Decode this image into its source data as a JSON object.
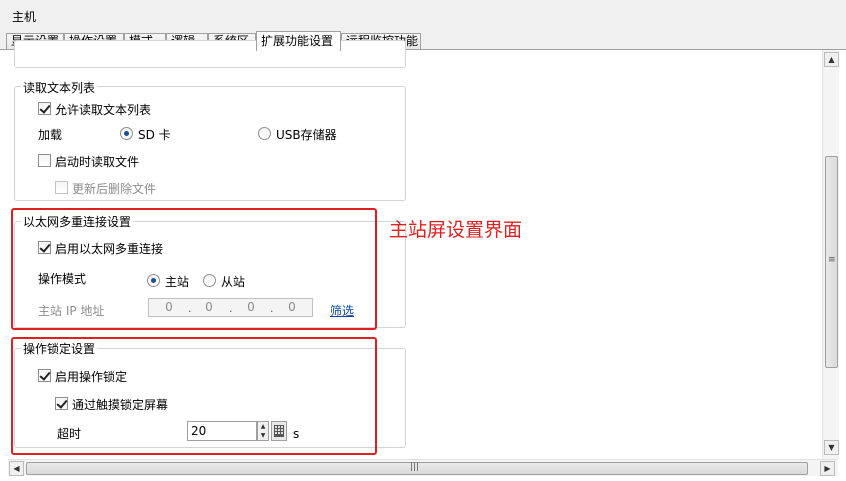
{
  "window": {
    "title": "主机"
  },
  "tabs": [
    {
      "label": "显示设置",
      "active": false
    },
    {
      "label": "操作设置",
      "active": false
    },
    {
      "label": "模式",
      "active": false
    },
    {
      "label": "逻辑",
      "active": false
    },
    {
      "label": "系统区",
      "active": false
    },
    {
      "label": "扩展功能设置",
      "active": true
    },
    {
      "label": "远程监控功能",
      "active": false
    }
  ],
  "read_text": {
    "title": "读取文本列表",
    "allow_label": "允许读取文本列表",
    "allow_checked": true,
    "load_label": "加载",
    "options": [
      "SD 卡",
      "USB存储器"
    ],
    "selected": "SD 卡",
    "startup_label": "启动时读取文件",
    "startup_checked": false,
    "delete_label": "更新后删除文件",
    "delete_checked": false
  },
  "ethernet": {
    "title": "以太网多重连接设置",
    "enable_label": "启用以太网多重连接",
    "enable_checked": true,
    "mode_label": "操作模式",
    "mode_options": [
      "主站",
      "从站"
    ],
    "mode_selected": "主站",
    "ip_label": "主站 IP 地址",
    "ip": [
      "0",
      "0",
      "0",
      "0"
    ],
    "filter_link": "筛选"
  },
  "annotation": {
    "text": "主站屏设置界面",
    "color": "#e02020"
  },
  "lock": {
    "title": "操作锁定设置",
    "enable_label": "启用操作锁定",
    "enable_checked": true,
    "touch_label": "通过触摸锁定屏幕",
    "touch_checked": true,
    "timeout_label": "超时",
    "timeout_value": "20",
    "unit": "s"
  },
  "colors": {
    "highlight": "#e02020",
    "link": "#0645ad"
  }
}
